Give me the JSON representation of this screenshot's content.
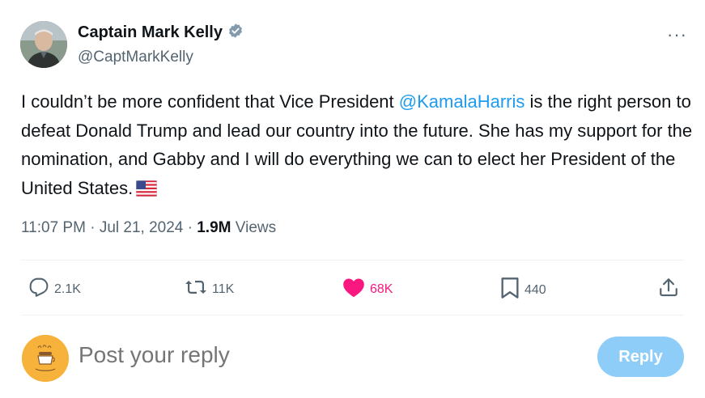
{
  "author": {
    "display_name": "Captain Mark Kelly",
    "handle": "@CaptMarkKelly",
    "verified_icon": "verified-badge-icon"
  },
  "more_label": "···",
  "tweet": {
    "text_before": "I couldn’t be more confident that Vice President ",
    "mention": "@KamalaHarris",
    "text_after": " is the right person to defeat Donald Trump and lead our country into the future. She has my support for the nomination, and Gabby and I will do everything we can to elect her President of the United States.",
    "flag_icon": "us-flag-icon"
  },
  "meta": {
    "time": "11:07 PM",
    "separator": "·",
    "date": "Jul 21, 2024",
    "views_count": "1.9M",
    "views_label": "Views"
  },
  "actions": {
    "replies": "2.1K",
    "reposts": "11K",
    "likes": "68K",
    "bookmarks": "440"
  },
  "colors": {
    "accent": "#1d9bf0",
    "like": "#f91880",
    "muted": "#536471",
    "reply_button": "#8ecdf8"
  },
  "reply": {
    "placeholder": "Post your reply",
    "button_label": "Reply"
  }
}
